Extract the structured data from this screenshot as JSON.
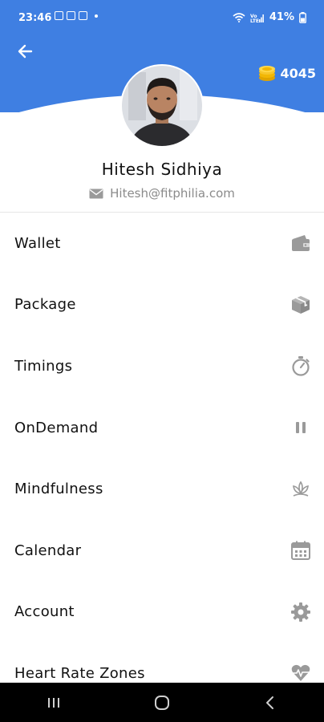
{
  "status": {
    "time": "23:46",
    "battery": "41%",
    "network": "LTE1"
  },
  "header": {
    "coins": "4045"
  },
  "profile": {
    "name": "Hitesh Sidhiya",
    "email": "Hitesh@fitphilia.com"
  },
  "menu": [
    {
      "label": "Wallet",
      "icon": "wallet-icon"
    },
    {
      "label": "Package",
      "icon": "package-icon"
    },
    {
      "label": "Timings",
      "icon": "stopwatch-icon"
    },
    {
      "label": "OnDemand",
      "icon": "pause-icon"
    },
    {
      "label": "Mindfulness",
      "icon": "lotus-icon"
    },
    {
      "label": "Calendar",
      "icon": "calendar-icon"
    },
    {
      "label": "Account",
      "icon": "gear-icon"
    },
    {
      "label": "Heart Rate Zones",
      "icon": "heart-rate-icon"
    }
  ],
  "colors": {
    "header": "#3f7fe2",
    "icon_grey": "#9a9a9a",
    "nav_bar": "#000000"
  }
}
